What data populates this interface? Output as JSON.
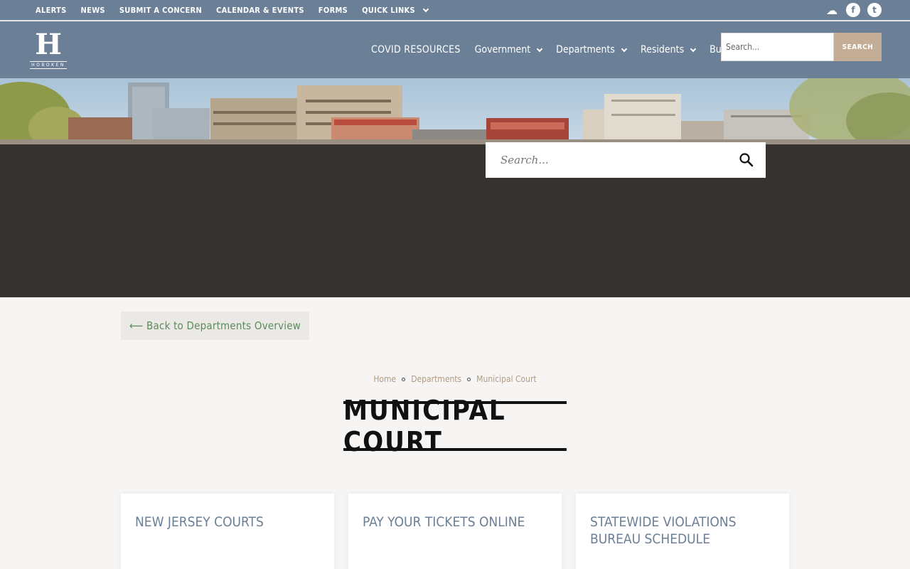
{
  "utility_bar": {
    "links": [
      "ALERTS",
      "NEWS",
      "SUBMIT A CONCERN",
      "CALENDAR & EVENTS",
      "FORMS"
    ],
    "quick_links": "QUICK LINKS",
    "icons": [
      "weather-icon",
      "facebook-icon",
      "twitter-icon"
    ],
    "facebook_glyph": "f",
    "twitter_glyph": "t",
    "weather_glyph": "☁"
  },
  "header": {
    "logo_letter": "H",
    "logo_word": "HOBOKEN",
    "nav": {
      "covid": "COVID RESOURCES",
      "government": "Government",
      "departments": "Departments",
      "residents": "Residents",
      "business": "Business"
    },
    "search_placeholder": "Search...",
    "search_button": "SEARCH"
  },
  "hero": {
    "search_placeholder": "Search..."
  },
  "back_link": "⟵ Back to Departments Overview",
  "breadcrumb": [
    "Home",
    "Departments",
    "Municipal Court"
  ],
  "page_title": "MUNICIPAL COURT",
  "cards": [
    {
      "title": "NEW JERSEY COURTS"
    },
    {
      "title": "PAY YOUR TICKETS ONLINE"
    },
    {
      "title": "STATEWIDE VIOLATIONS BUREAU SCHEDULE"
    }
  ],
  "colors": {
    "header_bg": "#6b8096",
    "hero_dark": "#363230",
    "accent_tan": "#c4ad96",
    "link_green": "#5c8b5b",
    "page_bg": "#f6f5f3"
  }
}
